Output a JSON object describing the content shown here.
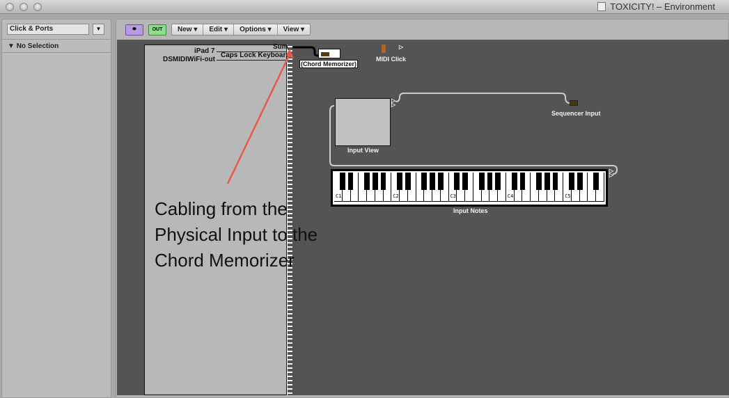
{
  "window": {
    "title": "TOXICITY! – Environment"
  },
  "sidebar": {
    "layer": "Click & Ports",
    "selection": "No Selection"
  },
  "toolbar": {
    "link_label": "🔗",
    "out_label": "OUT",
    "menus": [
      "New",
      "Edit",
      "Options",
      "View"
    ]
  },
  "environment": {
    "physical_input": {
      "outputs": [
        "Sum",
        "iPad 7",
        "Caps Lock Keyboard",
        "DSMIDIWiFi-out"
      ]
    },
    "objects": {
      "chord_memorizer": "(Chord Memorizer)",
      "midi_click": "MIDI Click",
      "sequencer_input": "Sequencer Input",
      "input_view": "Input View",
      "input_notes": "Input Notes"
    },
    "keyboard": {
      "octave_labels": [
        "C1",
        "C2",
        "C3",
        "C4",
        "C5"
      ]
    }
  },
  "annotation": {
    "text": "Cabling from the Physical Input to the Chord Memorizer",
    "color": "#e8584a"
  }
}
